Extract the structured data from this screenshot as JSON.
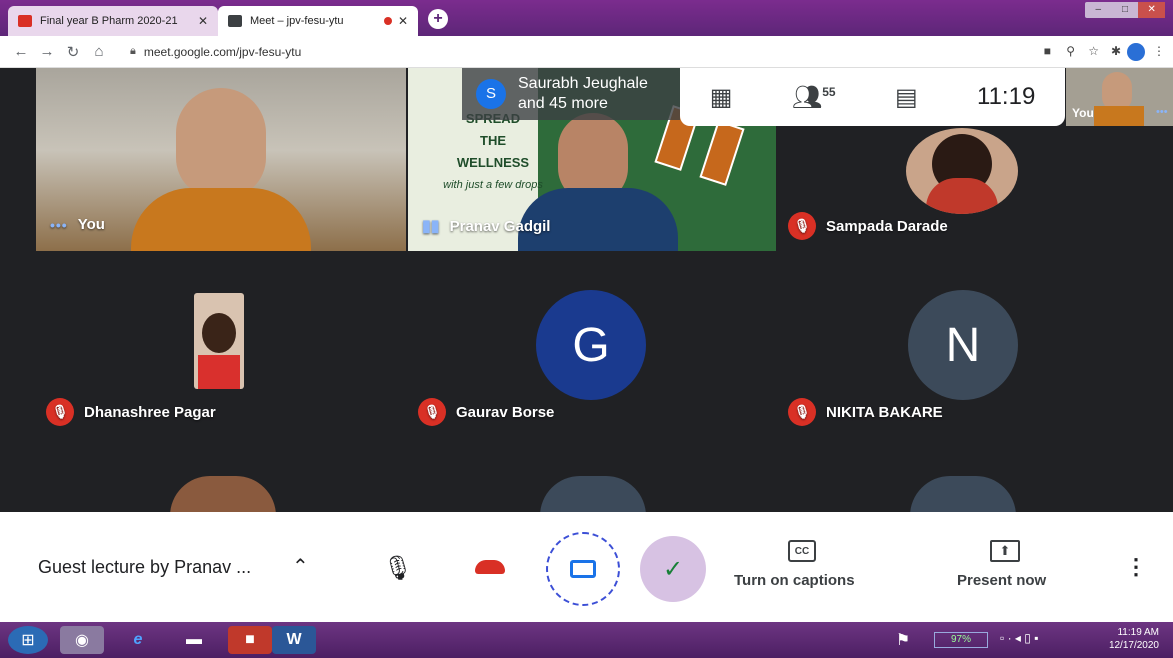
{
  "browser": {
    "tabs": [
      {
        "title": "Final year B Pharm 2020-21"
      },
      {
        "title": "Meet – jpv-fesu-ytu"
      }
    ],
    "url": "meet.google.com/jpv-fesu-ytu",
    "new_tab_symbol": "+"
  },
  "meet": {
    "speaker": {
      "initial": "S",
      "line1": "Saurabh Jeughale",
      "line2": "and 45 more"
    },
    "participant_count": "55",
    "clock": "11:19",
    "self_thumb_label": "You",
    "tiles": [
      {
        "name": "You"
      },
      {
        "name": "Pranav Gadgil"
      },
      {
        "name": "Sampada Darade"
      },
      {
        "name": "Dhanashree Pagar"
      },
      {
        "name": "Gaurav Borse",
        "initial": "G"
      },
      {
        "name": "NIKITA BAKARE",
        "initial": "N"
      }
    ],
    "banner_text": {
      "l1": "SPREAD",
      "l2": "THE",
      "l3": "WELLNESS",
      "l4": "with just a few drops"
    },
    "meeting_title": "Guest lecture by Pranav ...",
    "captions_label": "Turn on captions",
    "present_label": "Present now",
    "colors": {
      "accent": "#1a73e8",
      "mute_red": "#d93025",
      "avatar_g": "#1a3a8f",
      "avatar_n": "#3c4a5a"
    }
  },
  "taskbar": {
    "time": "11:19 AM",
    "date": "12/17/2020",
    "battery": "97%"
  }
}
